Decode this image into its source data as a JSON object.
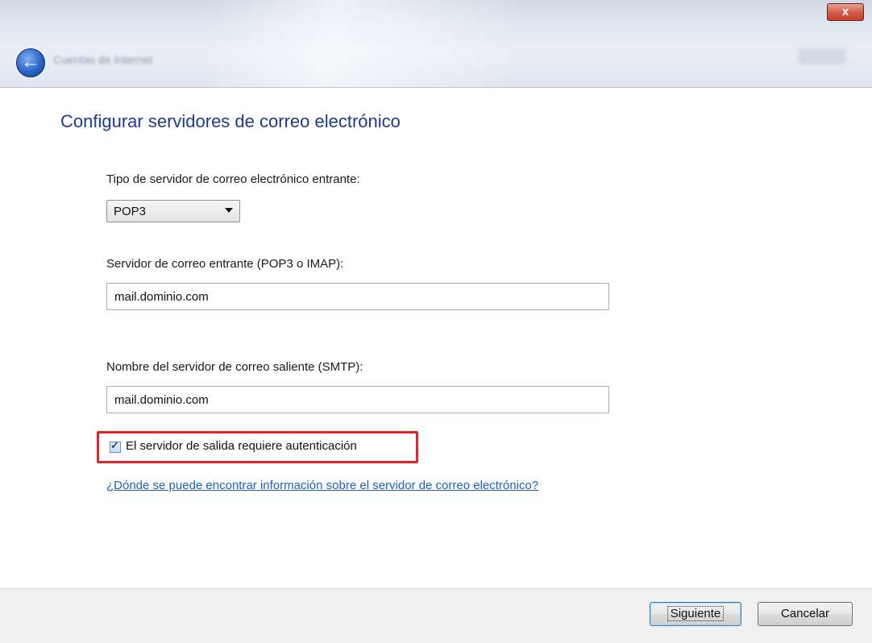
{
  "window": {
    "title": "Cuentas de Internet",
    "close_symbol": "x",
    "back_symbol": "←"
  },
  "main": {
    "heading": "Configurar servidores de correo electrónico",
    "incoming_type_label": "Tipo de servidor de correo electrónico entrante:",
    "incoming_type_value": "POP3",
    "incoming_server_label": "Servidor de correo entrante (POP3 o IMAP):",
    "incoming_server_value": "mail.dominio.com",
    "outgoing_server_label": "Nombre del servidor de correo saliente (SMTP):",
    "outgoing_server_value": "mail.dominio.com",
    "auth_checkbox_label": "El servidor de salida requiere autenticación",
    "auth_checked": true,
    "check_mark": "✓",
    "help_link": "¿Dónde se puede encontrar información sobre el servidor de correo electrónico?"
  },
  "footer": {
    "next_label": "Siguiente",
    "cancel_label": "Cancelar"
  },
  "colors": {
    "heading": "#1e3a8a",
    "link": "#1a5fc9",
    "highlight_border": "#e0242a"
  }
}
